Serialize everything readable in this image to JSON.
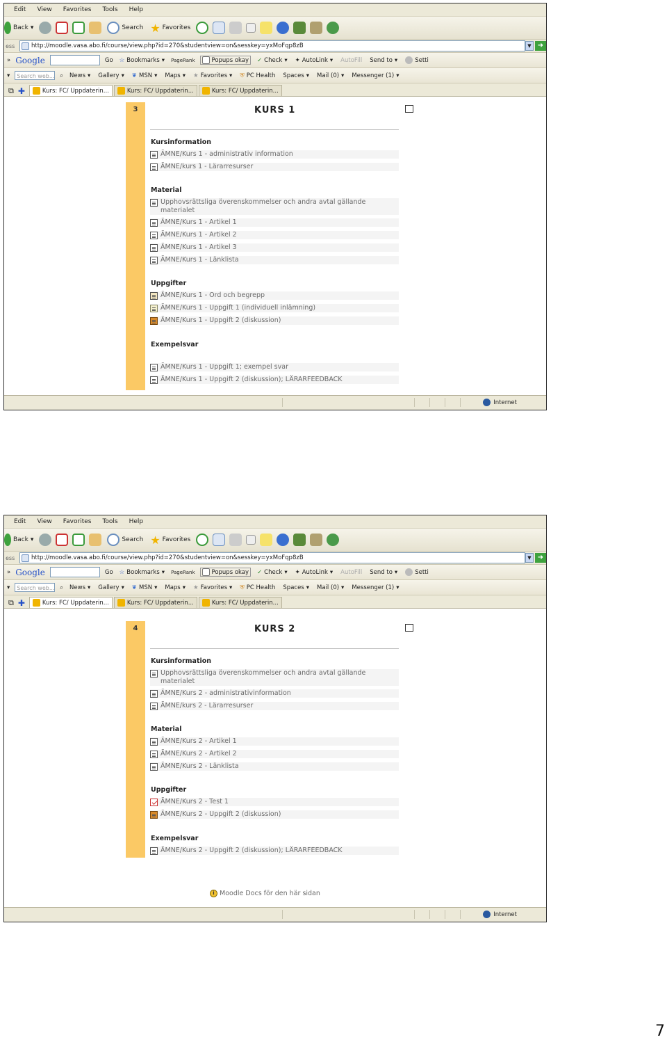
{
  "browser": {
    "menu": [
      "Edit",
      "View",
      "Favorites",
      "Tools",
      "Help"
    ],
    "toolbar": {
      "back": "Back",
      "search": "Search",
      "favorites": "Favorites"
    },
    "address": {
      "label": "ess",
      "url": "http://moodle.vasa.abo.fi/course/view.php?id=270&studentview=on&sesskey=yxMoFqp8zB"
    },
    "google_bar": {
      "logo": "Google",
      "go": "Go",
      "bookmarks": "Bookmarks",
      "pagerank": "PageRank",
      "popups": "Popups okay",
      "check": "Check",
      "autolink": "AutoLink",
      "autofill": "AutoFill",
      "sendto": "Send to",
      "settings": "Setti"
    },
    "live_bar": {
      "search_placeholder": "Search web...",
      "news": "News",
      "gallery": "Gallery",
      "msn": "MSN",
      "maps": "Maps",
      "favorites": "Favorites",
      "pchealth": "PC Health",
      "spaces": "Spaces",
      "mail": "Mail (0)",
      "messenger": "Messenger (1)"
    },
    "tabs": [
      "Kurs: FC/ Uppdaterin...",
      "Kurs: FC/ Uppdaterin...",
      "Kurs: FC/ Uppdaterin..."
    ],
    "status_zone": "Internet",
    "colors": {
      "chrome": "#ece9d8",
      "stripe": "#fbc965",
      "link": "#6a6a6a"
    }
  },
  "screens": [
    {
      "section_number": "3",
      "title": "KURS 1",
      "groups": [
        {
          "heading": "Kursinformation",
          "items": [
            {
              "icon": "page-icon",
              "label": "ÄMNE/Kurs 1 - administrativ information"
            },
            {
              "icon": "page-icon",
              "label": "ÄMNE/kurs 1 - Lärarresurser"
            }
          ]
        },
        {
          "heading": "Material",
          "items": [
            {
              "icon": "page-icon",
              "label": "Upphovsrättsliga överenskommelser och andra avtal gällande materialet"
            },
            {
              "icon": "page-icon",
              "label": "ÄMNE/Kurs 1 - Artikel 1"
            },
            {
              "icon": "page-icon",
              "label": "ÄMNE/Kurs 1 - Artikel 2"
            },
            {
              "icon": "page-icon",
              "label": "ÄMNE/Kurs 1 - Artikel 3"
            },
            {
              "icon": "page-icon",
              "label": "ÄMNE/Kurs 1 - Länklista"
            }
          ]
        },
        {
          "heading": "Uppgifter",
          "items": [
            {
              "icon": "glossary-icon",
              "label": "ÄMNE/Kurs 1 - Ord och begrepp"
            },
            {
              "icon": "assignment-icon",
              "label": "ÄMNE/Kurs 1 - Uppgift 1 (individuell inlämning)"
            },
            {
              "icon": "forum-icon",
              "label": "ÄMNE/Kurs 1 - Uppgift 2 (diskussion)"
            }
          ]
        },
        {
          "heading": "Exempelsvar",
          "items": [
            {
              "icon": "page-icon",
              "label": "ÄMNE/Kurs 1 - Uppgift 1; exempel svar"
            },
            {
              "icon": "page-icon",
              "label": "ÄMNE/Kurs 1 - Uppgift 2 (diskussion); LÄRARFEEDBACK"
            }
          ]
        }
      ]
    },
    {
      "section_number": "4",
      "title": "KURS 2",
      "groups": [
        {
          "heading": "Kursinformation",
          "items": [
            {
              "icon": "page-icon",
              "label": "Upphovsrättsliga överenskommelser och andra avtal gällande materialet"
            },
            {
              "icon": "page-icon",
              "label": "ÄMNE/Kurs 2 - administrativinformation"
            },
            {
              "icon": "page-icon",
              "label": "ÄMNE/kurs 2 - Lärarresurser"
            }
          ]
        },
        {
          "heading": "Material",
          "items": [
            {
              "icon": "page-icon",
              "label": "ÄMNE/Kurs 2 - Artikel 1"
            },
            {
              "icon": "page-icon",
              "label": "ÄMNE/Kurs 2 - Artikel 2"
            },
            {
              "icon": "page-icon",
              "label": "ÄMNE/Kurs 2 - Länklista"
            }
          ]
        },
        {
          "heading": "Uppgifter",
          "items": [
            {
              "icon": "quiz-icon",
              "label": "ÄMNE/Kurs 2 - Test 1"
            },
            {
              "icon": "forum-icon",
              "label": "ÄMNE/Kurs 2 - Uppgift 2 (diskussion)"
            }
          ]
        },
        {
          "heading": "Exempelsvar",
          "items": [
            {
              "icon": "page-icon",
              "label": "ÄMNE/Kurs 2 - Uppgift 2 (diskussion); LÄRARFEEDBACK"
            }
          ]
        }
      ],
      "footer_link": "Moodle Docs för den här sidan"
    }
  ],
  "page_number": "7"
}
